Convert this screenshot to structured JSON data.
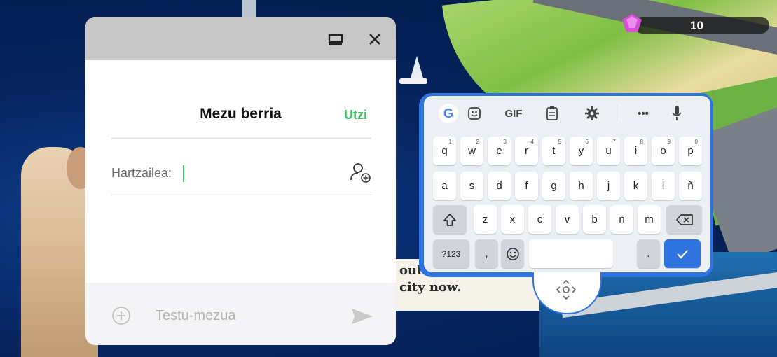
{
  "game": {
    "gem_count": "10",
    "billboard_line1": "oul",
    "billboard_line2": "city now."
  },
  "dialog": {
    "title": "Mezu berria",
    "cancel_label": "Utzi",
    "recipient_label": "Hartzailea:",
    "message_placeholder": "Testu-mezua"
  },
  "keyboard": {
    "toolbar_gif": "GIF",
    "toolbar_more": "•••",
    "row1": [
      {
        "label": "q",
        "hint": "1"
      },
      {
        "label": "w",
        "hint": "2"
      },
      {
        "label": "e",
        "hint": "3"
      },
      {
        "label": "r",
        "hint": "4"
      },
      {
        "label": "t",
        "hint": "5"
      },
      {
        "label": "y",
        "hint": "6"
      },
      {
        "label": "u",
        "hint": "7"
      },
      {
        "label": "i",
        "hint": "8"
      },
      {
        "label": "o",
        "hint": "9"
      },
      {
        "label": "p",
        "hint": "0"
      }
    ],
    "row2": [
      "a",
      "s",
      "d",
      "f",
      "g",
      "h",
      "j",
      "k",
      "l",
      "ñ"
    ],
    "row3": [
      "z",
      "x",
      "c",
      "v",
      "b",
      "n",
      "m"
    ],
    "symbols_label": "?123",
    "comma_label": ",",
    "period_label": "."
  },
  "colors": {
    "accent_green": "#3fbf64",
    "keyboard_blue": "#2f73e0",
    "gem_pink": "#d64fd6"
  }
}
